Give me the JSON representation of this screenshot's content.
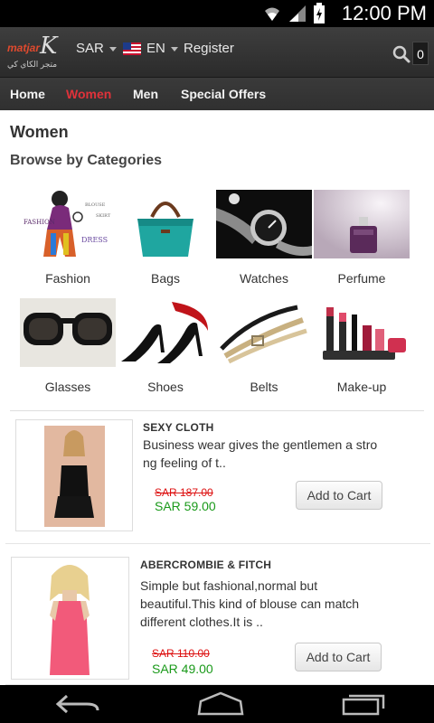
{
  "status_bar": {
    "time": "12:00 PM"
  },
  "header": {
    "logo_word": "matjar",
    "logo_letter": "K",
    "logo_arabic": "متجر الكاي كي",
    "currency": "SAR",
    "language": "EN",
    "register_label": "Register",
    "cart_count": "0"
  },
  "nav": {
    "items": [
      {
        "label": "Home"
      },
      {
        "label": "Women"
      },
      {
        "label": "Men"
      },
      {
        "label": "Special Offers"
      }
    ]
  },
  "page": {
    "title": "Women",
    "section_title": "Browse by Categories"
  },
  "categories": [
    {
      "label": "Fashion",
      "icon": "fashion-image"
    },
    {
      "label": "Bags",
      "icon": "bag-image"
    },
    {
      "label": "Watches",
      "icon": "watch-image"
    },
    {
      "label": "Perfume",
      "icon": "perfume-image"
    },
    {
      "label": "Glasses",
      "icon": "sunglasses-image"
    },
    {
      "label": "Shoes",
      "icon": "heels-image"
    },
    {
      "label": "Belts",
      "icon": "belt-image"
    },
    {
      "label": "Make-up",
      "icon": "makeup-image"
    }
  ],
  "fashion_thumb_text": {
    "t1": "FASHION",
    "t2": "DRESS",
    "t3": "BLOUSE",
    "t4": "SKIRT"
  },
  "products": [
    {
      "name": "SEXY CLOTH",
      "description_line1": "Business wear gives the gentlemen a stro",
      "description_line2": "ng feeling of t..",
      "description_line3": "",
      "old_price": "SAR 187.00",
      "new_price": "SAR 59.00",
      "button": "Add to Cart"
    },
    {
      "name": "ABERCROMBIE & FITCH",
      "description_line1": "Simple but fashional,normal but",
      "description_line2": "beautiful.This kind of blouse can match",
      "description_line3": "different clothes.It is ..",
      "old_price": "SAR 110.00",
      "new_price": "SAR 49.00",
      "button": "Add to Cart"
    }
  ],
  "colors": {
    "accent": "#e0323a",
    "price_new": "#1a9a1a",
    "price_old": "#dd1111",
    "header_bg": "#333333"
  }
}
